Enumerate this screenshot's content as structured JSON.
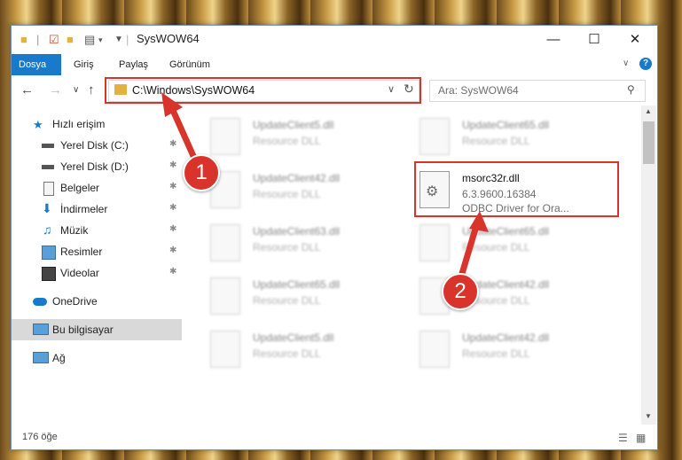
{
  "window": {
    "title": "SysWOW64"
  },
  "ribbon": {
    "tabs": [
      "Dosya",
      "Giriş",
      "Paylaş",
      "Görünüm"
    ]
  },
  "nav": {
    "address": "C:\\Windows\\SysWOW64",
    "search_placeholder": "Ara: SysWOW64"
  },
  "sidebar": {
    "items": [
      {
        "label": "Hızlı erişim",
        "icon": "star-icon"
      },
      {
        "label": "Yerel Disk (C:)",
        "icon": "drive-icon",
        "pinned": true
      },
      {
        "label": "Yerel Disk (D:)",
        "icon": "drive-icon",
        "pinned": true
      },
      {
        "label": "Belgeler",
        "icon": "documents-icon",
        "pinned": true
      },
      {
        "label": "İndirmeler",
        "icon": "download-icon",
        "pinned": true
      },
      {
        "label": "Müzik",
        "icon": "music-icon",
        "pinned": true
      },
      {
        "label": "Resimler",
        "icon": "pictures-icon",
        "pinned": true
      },
      {
        "label": "Videolar",
        "icon": "videos-icon",
        "pinned": true
      },
      {
        "label": "OneDrive",
        "icon": "cloud-icon"
      },
      {
        "label": "Bu bilgisayar",
        "icon": "computer-icon",
        "selected": true
      },
      {
        "label": "Ağ",
        "icon": "network-icon"
      }
    ]
  },
  "files": [
    {
      "name": "UpdateClient5.dll",
      "desc": "Resource DLL"
    },
    {
      "name": "UpdateClient65.dll",
      "desc": "Resource DLL"
    },
    {
      "name": "UpdateClient42.dll",
      "desc": "Resource DLL"
    },
    {
      "name": "msorc32r.dll",
      "version": "6.3.9600.16384",
      "desc": "ODBC Driver for Ora...",
      "highlighted": true
    },
    {
      "name": "UpdateClient63.dll",
      "desc": "Resource DLL"
    },
    {
      "name": "UpdateClient65.dll",
      "desc": "Resource DLL"
    },
    {
      "name": "UpdateClient65.dll",
      "desc": "Resource DLL"
    },
    {
      "name": "UpdateClient42.dll",
      "desc": "Resource DLL"
    },
    {
      "name": "UpdateClient5.dll",
      "desc": "Resource DLL"
    },
    {
      "name": "UpdateClient42.dll",
      "desc": "Resource DLL"
    }
  ],
  "status": {
    "item_count": "176 öğe"
  },
  "annotations": {
    "marker1": "1",
    "marker2": "2",
    "color": "#d9342b"
  }
}
